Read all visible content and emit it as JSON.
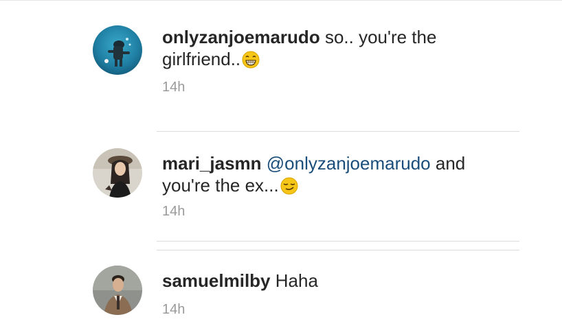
{
  "comments": [
    {
      "username": "onlyzanjoemarudo",
      "mention": "",
      "body": "so.. you're the girlfriend..",
      "emoji": "grinning-face-emoji",
      "time": "14h"
    },
    {
      "username": "mari_jasmn",
      "mention": "@onlyzanjoemarudo",
      "body": "and you're the ex...",
      "emoji": "smirking-face-emoji",
      "time": "14h"
    },
    {
      "username": "samuelmilby",
      "mention": "",
      "body": "Haha",
      "emoji": "",
      "time": "14h"
    }
  ],
  "colors": {
    "username": "#262626",
    "mention": "#1a4d7a",
    "timestamp": "#9a9a9a",
    "emoji": "#f5c518"
  }
}
